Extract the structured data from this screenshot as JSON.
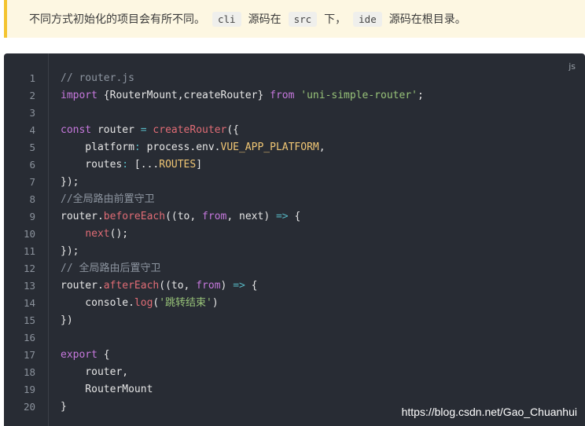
{
  "tip": {
    "text_1": "不同方式初始化的项目会有所不同。",
    "code_1": "cli",
    "text_2": "源码在",
    "code_2": "src",
    "text_3": "下，",
    "code_3": "ide",
    "text_4": "源码在根目录。"
  },
  "code_block": {
    "language": "js",
    "line_numbers": [
      "1",
      "2",
      "3",
      "4",
      "5",
      "6",
      "7",
      "8",
      "9",
      "10",
      "11",
      "12",
      "13",
      "14",
      "15",
      "16",
      "17",
      "18",
      "19",
      "20"
    ],
    "lines": [
      [
        {
          "t": "// router.js",
          "c": "com"
        }
      ],
      [
        {
          "t": "import",
          "c": "kw"
        },
        {
          "t": " {RouterMount,createRouter} "
        },
        {
          "t": "from",
          "c": "kw"
        },
        {
          "t": " "
        },
        {
          "t": "'uni-simple-router'",
          "c": "str"
        },
        {
          "t": ";"
        }
      ],
      [],
      [
        {
          "t": "const",
          "c": "kw"
        },
        {
          "t": " router "
        },
        {
          "t": "=",
          "c": "op"
        },
        {
          "t": " "
        },
        {
          "t": "createRouter",
          "c": "fn"
        },
        {
          "t": "({"
        }
      ],
      [
        {
          "t": "    platform"
        },
        {
          "t": ":",
          "c": "op"
        },
        {
          "t": " process.env."
        },
        {
          "t": "VUE_APP_PLATFORM",
          "c": "prop"
        },
        {
          "t": ","
        }
      ],
      [
        {
          "t": "    routes"
        },
        {
          "t": ":",
          "c": "op"
        },
        {
          "t": " [..."
        },
        {
          "t": "ROUTES",
          "c": "prop"
        },
        {
          "t": "]"
        }
      ],
      [
        {
          "t": "});"
        }
      ],
      [
        {
          "t": "//全局路由前置守卫",
          "c": "com"
        }
      ],
      [
        {
          "t": "router."
        },
        {
          "t": "beforeEach",
          "c": "fn"
        },
        {
          "t": "((to, "
        },
        {
          "t": "from",
          "c": "kw"
        },
        {
          "t": ", next) "
        },
        {
          "t": "=>",
          "c": "op"
        },
        {
          "t": " {"
        }
      ],
      [
        {
          "t": "    "
        },
        {
          "t": "next",
          "c": "fn"
        },
        {
          "t": "();"
        }
      ],
      [
        {
          "t": "});"
        }
      ],
      [
        {
          "t": "// 全局路由后置守卫",
          "c": "com"
        }
      ],
      [
        {
          "t": "router."
        },
        {
          "t": "afterEach",
          "c": "fn"
        },
        {
          "t": "((to, "
        },
        {
          "t": "from",
          "c": "kw"
        },
        {
          "t": ") "
        },
        {
          "t": "=>",
          "c": "op"
        },
        {
          "t": " {"
        }
      ],
      [
        {
          "t": "    console."
        },
        {
          "t": "log",
          "c": "fn"
        },
        {
          "t": "("
        },
        {
          "t": "'跳转结束'",
          "c": "str"
        },
        {
          "t": ")"
        }
      ],
      [
        {
          "t": "})"
        }
      ],
      [],
      [
        {
          "t": "export",
          "c": "kw"
        },
        {
          "t": " {"
        }
      ],
      [
        {
          "t": "    router,"
        }
      ],
      [
        {
          "t": "    RouterMount"
        }
      ],
      [
        {
          "t": "}"
        }
      ]
    ]
  },
  "watermark": "https://blog.csdn.net/Gao_Chuanhui",
  "colors": {
    "code_background": "#282c34",
    "tip_background": "#fdf7e2",
    "tip_border": "#f4c430"
  }
}
